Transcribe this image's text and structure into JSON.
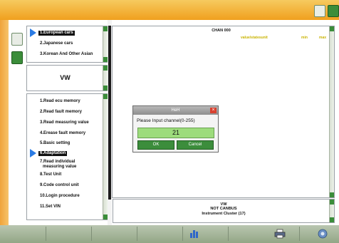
{
  "categories": {
    "items": [
      "1.European cars",
      "2.Japanese cars",
      "3.Korean And Other Asian"
    ],
    "selected_index": 0
  },
  "make_panel": {
    "value": "VW"
  },
  "functions": {
    "items": [
      "1.Read ecu memory",
      "2.Read fault memory",
      "3.Read measuring value",
      "4.Erease fault memory",
      "5.Basic setting",
      "6.Adaptation",
      "7.Read individual",
      "measuring value",
      "8.Test Unit",
      "9.Code control unit",
      "10.Login procedure",
      "11.Set VIN"
    ],
    "selected_index": 5
  },
  "data_area": {
    "title": "CHAN 000",
    "columns": [
      "value/statesunit",
      "min",
      "max"
    ]
  },
  "dialog": {
    "title": "HeH",
    "prompt": "Please Input channel(0-255)",
    "input_value": "21",
    "ok_label": "OK",
    "cancel_label": "Cancel"
  },
  "status": {
    "lines": [
      "VW",
      "NOT CANBUS",
      "Instrument Cluster (17)"
    ]
  },
  "icons": {
    "top_left": "edit-icon",
    "top_right": "exit-icon",
    "tool_1": "pencil-icon",
    "tool_2": "device-icon",
    "bottom_1": "chart-icon",
    "bottom_2": "printer-icon",
    "bottom_3": "settings-icon"
  },
  "colors": {
    "accent": "#f0a01e",
    "green": "#3b8d3a",
    "selection": "#2a7be4"
  }
}
